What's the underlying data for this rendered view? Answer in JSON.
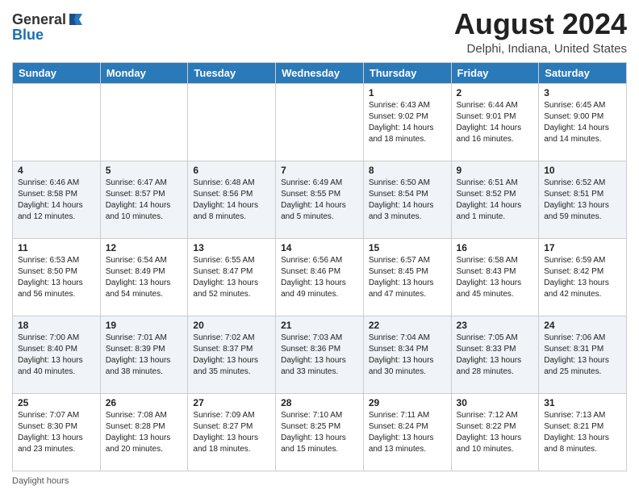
{
  "header": {
    "logo_line1": "General",
    "logo_line2": "Blue",
    "title": "August 2024",
    "subtitle": "Delphi, Indiana, United States"
  },
  "weekdays": [
    "Sunday",
    "Monday",
    "Tuesday",
    "Wednesday",
    "Thursday",
    "Friday",
    "Saturday"
  ],
  "weeks": [
    [
      {
        "day": "",
        "info": ""
      },
      {
        "day": "",
        "info": ""
      },
      {
        "day": "",
        "info": ""
      },
      {
        "day": "",
        "info": ""
      },
      {
        "day": "1",
        "info": "Sunrise: 6:43 AM\nSunset: 9:02 PM\nDaylight: 14 hours and 18 minutes."
      },
      {
        "day": "2",
        "info": "Sunrise: 6:44 AM\nSunset: 9:01 PM\nDaylight: 14 hours and 16 minutes."
      },
      {
        "day": "3",
        "info": "Sunrise: 6:45 AM\nSunset: 9:00 PM\nDaylight: 14 hours and 14 minutes."
      }
    ],
    [
      {
        "day": "4",
        "info": "Sunrise: 6:46 AM\nSunset: 8:58 PM\nDaylight: 14 hours and 12 minutes."
      },
      {
        "day": "5",
        "info": "Sunrise: 6:47 AM\nSunset: 8:57 PM\nDaylight: 14 hours and 10 minutes."
      },
      {
        "day": "6",
        "info": "Sunrise: 6:48 AM\nSunset: 8:56 PM\nDaylight: 14 hours and 8 minutes."
      },
      {
        "day": "7",
        "info": "Sunrise: 6:49 AM\nSunset: 8:55 PM\nDaylight: 14 hours and 5 minutes."
      },
      {
        "day": "8",
        "info": "Sunrise: 6:50 AM\nSunset: 8:54 PM\nDaylight: 14 hours and 3 minutes."
      },
      {
        "day": "9",
        "info": "Sunrise: 6:51 AM\nSunset: 8:52 PM\nDaylight: 14 hours and 1 minute."
      },
      {
        "day": "10",
        "info": "Sunrise: 6:52 AM\nSunset: 8:51 PM\nDaylight: 13 hours and 59 minutes."
      }
    ],
    [
      {
        "day": "11",
        "info": "Sunrise: 6:53 AM\nSunset: 8:50 PM\nDaylight: 13 hours and 56 minutes."
      },
      {
        "day": "12",
        "info": "Sunrise: 6:54 AM\nSunset: 8:49 PM\nDaylight: 13 hours and 54 minutes."
      },
      {
        "day": "13",
        "info": "Sunrise: 6:55 AM\nSunset: 8:47 PM\nDaylight: 13 hours and 52 minutes."
      },
      {
        "day": "14",
        "info": "Sunrise: 6:56 AM\nSunset: 8:46 PM\nDaylight: 13 hours and 49 minutes."
      },
      {
        "day": "15",
        "info": "Sunrise: 6:57 AM\nSunset: 8:45 PM\nDaylight: 13 hours and 47 minutes."
      },
      {
        "day": "16",
        "info": "Sunrise: 6:58 AM\nSunset: 8:43 PM\nDaylight: 13 hours and 45 minutes."
      },
      {
        "day": "17",
        "info": "Sunrise: 6:59 AM\nSunset: 8:42 PM\nDaylight: 13 hours and 42 minutes."
      }
    ],
    [
      {
        "day": "18",
        "info": "Sunrise: 7:00 AM\nSunset: 8:40 PM\nDaylight: 13 hours and 40 minutes."
      },
      {
        "day": "19",
        "info": "Sunrise: 7:01 AM\nSunset: 8:39 PM\nDaylight: 13 hours and 38 minutes."
      },
      {
        "day": "20",
        "info": "Sunrise: 7:02 AM\nSunset: 8:37 PM\nDaylight: 13 hours and 35 minutes."
      },
      {
        "day": "21",
        "info": "Sunrise: 7:03 AM\nSunset: 8:36 PM\nDaylight: 13 hours and 33 minutes."
      },
      {
        "day": "22",
        "info": "Sunrise: 7:04 AM\nSunset: 8:34 PM\nDaylight: 13 hours and 30 minutes."
      },
      {
        "day": "23",
        "info": "Sunrise: 7:05 AM\nSunset: 8:33 PM\nDaylight: 13 hours and 28 minutes."
      },
      {
        "day": "24",
        "info": "Sunrise: 7:06 AM\nSunset: 8:31 PM\nDaylight: 13 hours and 25 minutes."
      }
    ],
    [
      {
        "day": "25",
        "info": "Sunrise: 7:07 AM\nSunset: 8:30 PM\nDaylight: 13 hours and 23 minutes."
      },
      {
        "day": "26",
        "info": "Sunrise: 7:08 AM\nSunset: 8:28 PM\nDaylight: 13 hours and 20 minutes."
      },
      {
        "day": "27",
        "info": "Sunrise: 7:09 AM\nSunset: 8:27 PM\nDaylight: 13 hours and 18 minutes."
      },
      {
        "day": "28",
        "info": "Sunrise: 7:10 AM\nSunset: 8:25 PM\nDaylight: 13 hours and 15 minutes."
      },
      {
        "day": "29",
        "info": "Sunrise: 7:11 AM\nSunset: 8:24 PM\nDaylight: 13 hours and 13 minutes."
      },
      {
        "day": "30",
        "info": "Sunrise: 7:12 AM\nSunset: 8:22 PM\nDaylight: 13 hours and 10 minutes."
      },
      {
        "day": "31",
        "info": "Sunrise: 7:13 AM\nSunset: 8:21 PM\nDaylight: 13 hours and 8 minutes."
      }
    ]
  ],
  "footer": {
    "daylight_label": "Daylight hours"
  }
}
